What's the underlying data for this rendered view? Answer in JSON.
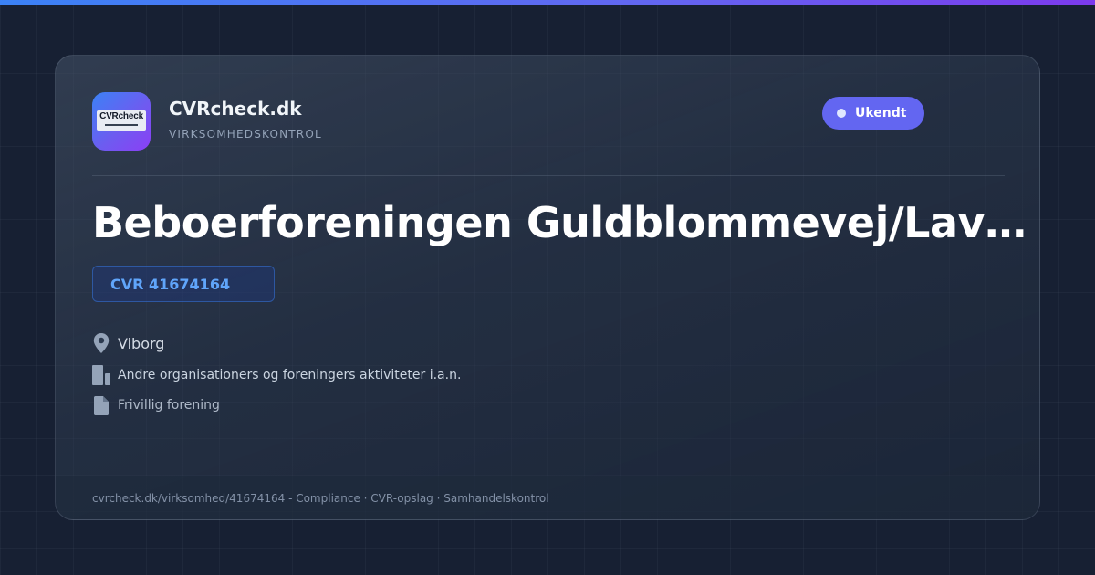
{
  "brand": {
    "logo_text": "CVRcheck",
    "name": "CVRcheck.dk",
    "tagline": "VIRKSOMHEDSKONTROL"
  },
  "status": {
    "label": "Ukendt"
  },
  "company": {
    "name": "Beboerforeningen Guldblommevej/Lavendelvej",
    "cvr": "CVR 41674164",
    "location": "Viborg",
    "industry": "Andre organisationers og foreningers aktiviteter i.a.n.",
    "legal_form": "Frivillig forening"
  },
  "footer": {
    "text": "cvrcheck.dk/virksomhed/41674164 - Compliance · CVR-opslag · Samhandelskontrol"
  },
  "icons": {
    "location": "map-pin-icon",
    "industry": "building-icon",
    "legal_form": "document-icon"
  },
  "colors": {
    "accent": "#6366f1",
    "cvr_text": "#60a5fa",
    "background": "#172033"
  }
}
